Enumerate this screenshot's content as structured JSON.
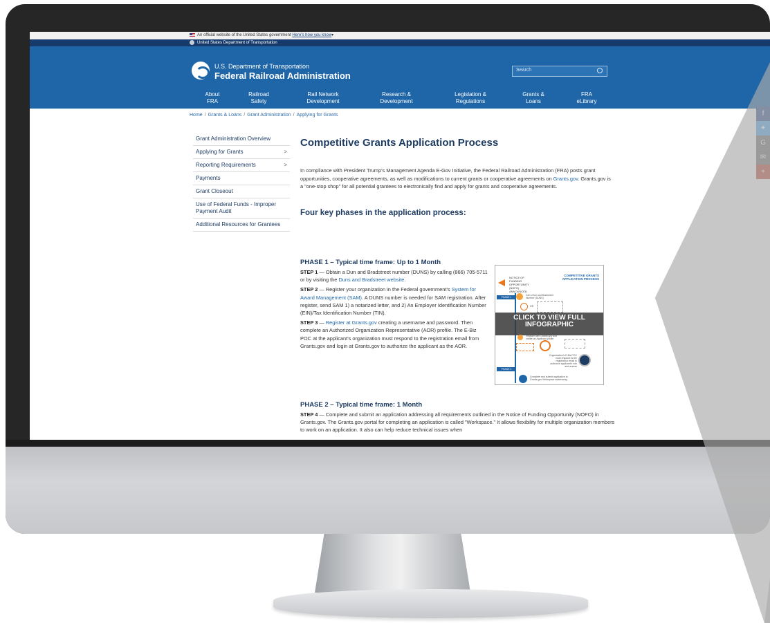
{
  "gov_banner": {
    "text": "An official website of the United States government",
    "link": "Here's how you know"
  },
  "dot_bar": {
    "text": "United States Department of Transportation"
  },
  "header": {
    "agency_top": "U.S. Department of Transportation",
    "agency_name": "Federal Railroad Administration",
    "search_placeholder": "Search"
  },
  "nav": [
    {
      "line1": "About",
      "line2": "FRA"
    },
    {
      "line1": "Railroad",
      "line2": "Safety"
    },
    {
      "line1": "Rail Network",
      "line2": "Development"
    },
    {
      "line1": "Research &",
      "line2": "Development"
    },
    {
      "line1": "Legislation &",
      "line2": "Regulations"
    },
    {
      "line1": "Grants &",
      "line2": "Loans"
    },
    {
      "line1": "FRA",
      "line2": "eLibrary"
    }
  ],
  "breadcrumb": [
    "Home",
    "Grants & Loans",
    "Grant Administration",
    "Applying for Grants"
  ],
  "sidebar": [
    {
      "label": "Grant Administration Overview"
    },
    {
      "label": "Applying for Grants",
      "chev": ">"
    },
    {
      "label": "Reporting Requirements",
      "chev": ">"
    },
    {
      "label": "Payments"
    },
    {
      "label": "Grant Closeout"
    },
    {
      "label": "Use of Federal Funds - Improper Payment Audit"
    },
    {
      "label": "Additional Resources for Grantees"
    }
  ],
  "content": {
    "title": "Competitive Grants Application Process",
    "intro_a": "In compliance with President Trump's Management Agenda E-Gov Initiative, the Federal Railroad Administration (FRA) posts grant opportunities, cooperative agreements, as well as modifications to current grants or cooperative agreements on ",
    "intro_link": "Grants.gov",
    "intro_b": ". Grants.gov is a \"one-stop shop\" for all potential grantees to electronically find and apply for grants and cooperative agreements.",
    "phases_heading": "Four key phases in the application process:",
    "phase1_heading": "PHASE 1 – Typical time frame: Up to 1 Month",
    "step1_label": "STEP 1",
    "step1_text": " — Obtain a Dun and Bradstreet number (DUNS) by calling (866) 705-5711 or by visiting the ",
    "step1_link": "Duns and Bradstreet website",
    "step2_label": "STEP 2",
    "step2_text": " — Register your organization in the Federal government's ",
    "step2_link": "System for Award Management (SAM)",
    "step2_text_b": ". A DUNS number is needed for SAM registration. After register, send SAM 1) a notarized letter, and 2) An Employer Identification Number (EIN)/Tax Identification Number (TIN).",
    "step3_label": "STEP 3",
    "step3_dash": " — ",
    "step3_link": "Register at Grants.gov",
    "step3_text": " creating a username and password. Then complete an Authorized Organization Representative (AOR) profile. The E-Biz POC at the applicant's organization must respond to the registration email from Grants.gov and login at Grants.gov to authorize the applicant as the AOR.",
    "phase2_heading": "PHASE 2 – Typical time frame: 1 Month",
    "step4_label": "STEP 4",
    "step4_text": " — Complete and submit an application addressing all requirements outlined in the Notice of Funding Opportunity (NOFO) in Grants.gov. The Grants.gov portal for completing an application is called \"Workspace.\" It allows flexibility for multiple organization members to work on an application. It also can help reduce technical issues when"
  },
  "infographic": {
    "title": "COMPETITIVE GRANTS APPLICATION PROCESS",
    "note": "NOTICE OF FUNDING OPPORTUNITY (NOFO) ANNOUNCED",
    "phase_badge_1": "PHASE 1",
    "phase_badge_2": "PHASE 2",
    "overlay_line1": "CLICK TO VIEW FULL",
    "overlay_line2": "INFOGRAPHIC",
    "small_1": "Get a Dun and Bradstreet Number (DUNS)",
    "small_or": "OR",
    "small_2": "Register with Grants.gov and create an Applicant profile",
    "small_3": "Organization's E-Biz POC must respond to the registration email to authorize applicant's role and access",
    "small_4": "Complete and submit application to Grants.gov Workspace addressing"
  },
  "share": [
    {
      "icon": "facebook-icon",
      "glyph": "f",
      "color": "#3b5998"
    },
    {
      "icon": "twitter-icon",
      "glyph": "✦",
      "color": "#55acee"
    },
    {
      "icon": "google-icon",
      "glyph": "G",
      "color": "#7a7a7a"
    },
    {
      "icon": "email-icon",
      "glyph": "✉",
      "color": "#7a7a7a"
    },
    {
      "icon": "plus-icon",
      "glyph": "+",
      "color": "#c0503f"
    }
  ]
}
